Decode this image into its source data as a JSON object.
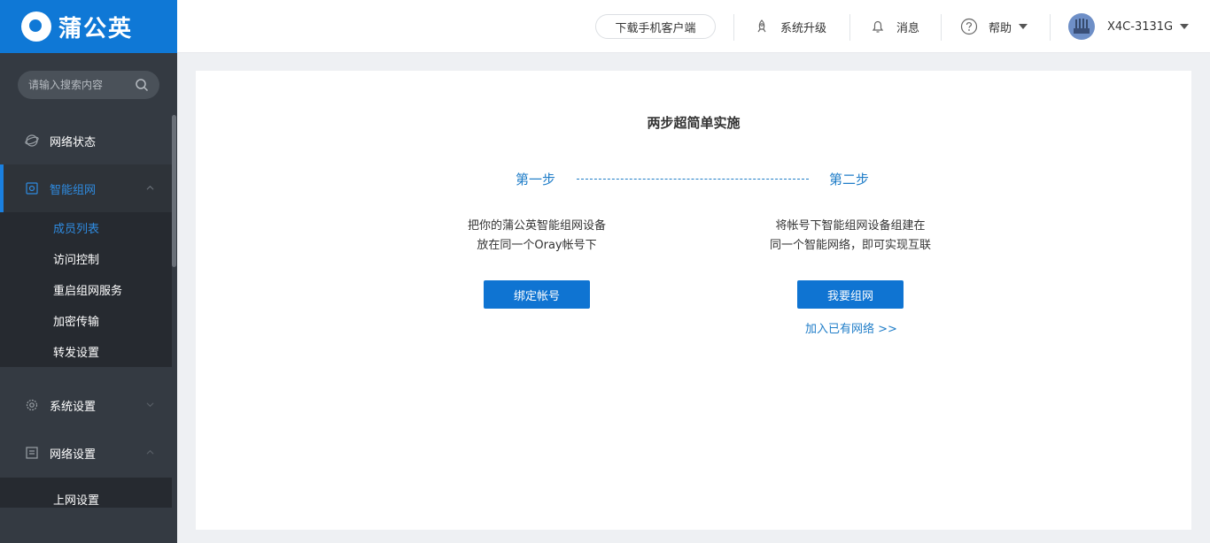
{
  "sidebar": {
    "logo_text": "蒲公英",
    "search_placeholder": "请输入搜索内容",
    "items": [
      {
        "label": "网络状态",
        "icon": "globe-icon"
      },
      {
        "label": "智能组网",
        "icon": "network-icon",
        "active": true,
        "expanded": true
      },
      {
        "label": "系统设置",
        "icon": "gear-icon"
      },
      {
        "label": "网络设置",
        "icon": "settings-list-icon",
        "expanded": true
      }
    ],
    "submenu_smart_network": [
      {
        "label": "成员列表",
        "active": true
      },
      {
        "label": "访问控制"
      },
      {
        "label": "重启组网服务"
      },
      {
        "label": "加密传输"
      },
      {
        "label": "转发设置"
      }
    ],
    "submenu_network_settings": [
      {
        "label": "上网设置"
      }
    ]
  },
  "header": {
    "download_app": "下载手机客户端",
    "upgrade": "系统升级",
    "messages": "消息",
    "help": "帮助",
    "device_name": "X4C-3131G"
  },
  "main": {
    "title": "两步超简单实施",
    "step1": {
      "label": "第一步",
      "desc_line1": "把你的蒲公英智能组网设备",
      "desc_line2": "放在同一个Oray帐号下",
      "button": "绑定帐号"
    },
    "step2": {
      "label": "第二步",
      "desc_line1": "将帐号下智能组网设备组建在",
      "desc_line2": "同一个智能网络，即可实现互联",
      "button": "我要组网",
      "link": "加入已有网络 >>"
    }
  },
  "colors": {
    "brand_blue": "#0f78d6",
    "sidebar_bg": "#343a42",
    "active_text": "#2f8be0"
  }
}
